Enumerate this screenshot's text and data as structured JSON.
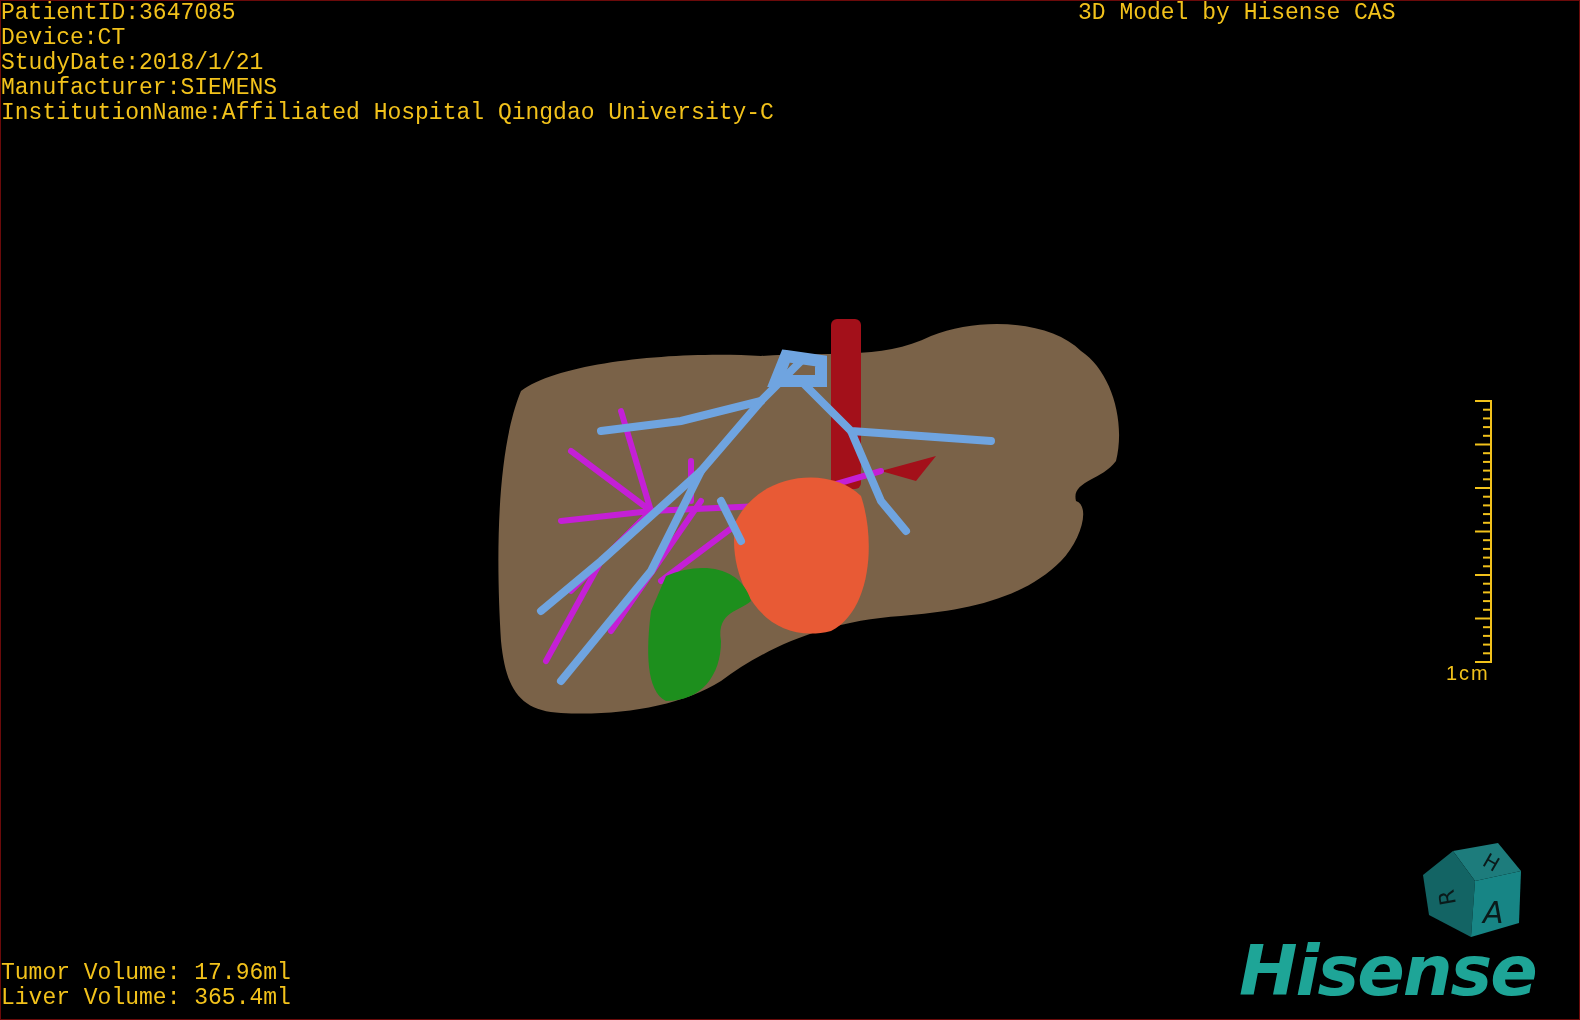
{
  "patient_info": [
    "PatientID:3647085",
    "Device:CT",
    "StudyDate:2018/1/21",
    "Manufacturer:SIEMENS",
    "InstitutionName:Affiliated Hospital Qingdao University-C"
  ],
  "title": "3D Model by Hisense CAS",
  "scale_bar": {
    "label": "1cm"
  },
  "orientation_cube": {
    "faces": [
      "H",
      "R",
      "A"
    ]
  },
  "volumes": [
    "Tumor Volume: 17.96ml",
    "Liver Volume: 365.4ml"
  ],
  "logo": "Hisense"
}
